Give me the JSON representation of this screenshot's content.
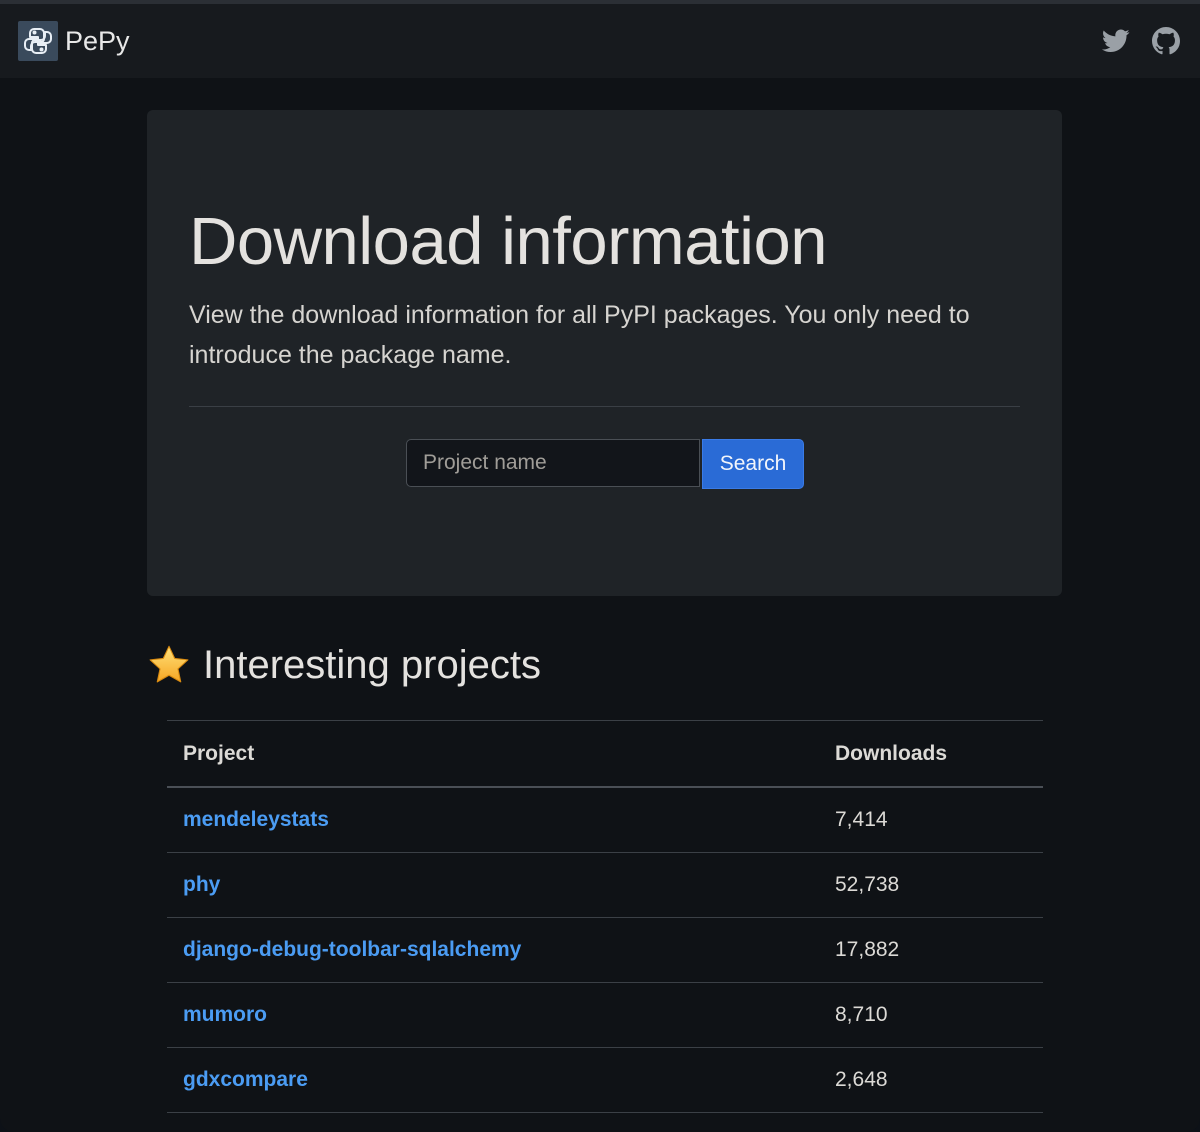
{
  "navbar": {
    "brand": "PePy",
    "icons": [
      "python-logo-icon",
      "twitter-icon",
      "github-icon"
    ]
  },
  "hero": {
    "title": "Download information",
    "lead": "View the download information for all PyPI packages. You only need to introduce the package name.",
    "search": {
      "placeholder": "Project name",
      "value": "",
      "button_label": "Search"
    }
  },
  "interesting": {
    "title": "Interesting projects",
    "icon": "star-icon",
    "columns": [
      "Project",
      "Downloads"
    ],
    "rows": [
      {
        "project": "mendeleystats",
        "downloads": "7,414"
      },
      {
        "project": "phy",
        "downloads": "52,738"
      },
      {
        "project": "django-debug-toolbar-sqlalchemy",
        "downloads": "17,882"
      },
      {
        "project": "mumoro",
        "downloads": "8,710"
      },
      {
        "project": "gdxcompare",
        "downloads": "2,648"
      }
    ]
  },
  "colors": {
    "page_bg": "#0f1216",
    "navbar_bg": "#171a1e",
    "hero_bg": "#1f2327",
    "accent": "#2a6bd6",
    "link": "#4b9cf3"
  }
}
